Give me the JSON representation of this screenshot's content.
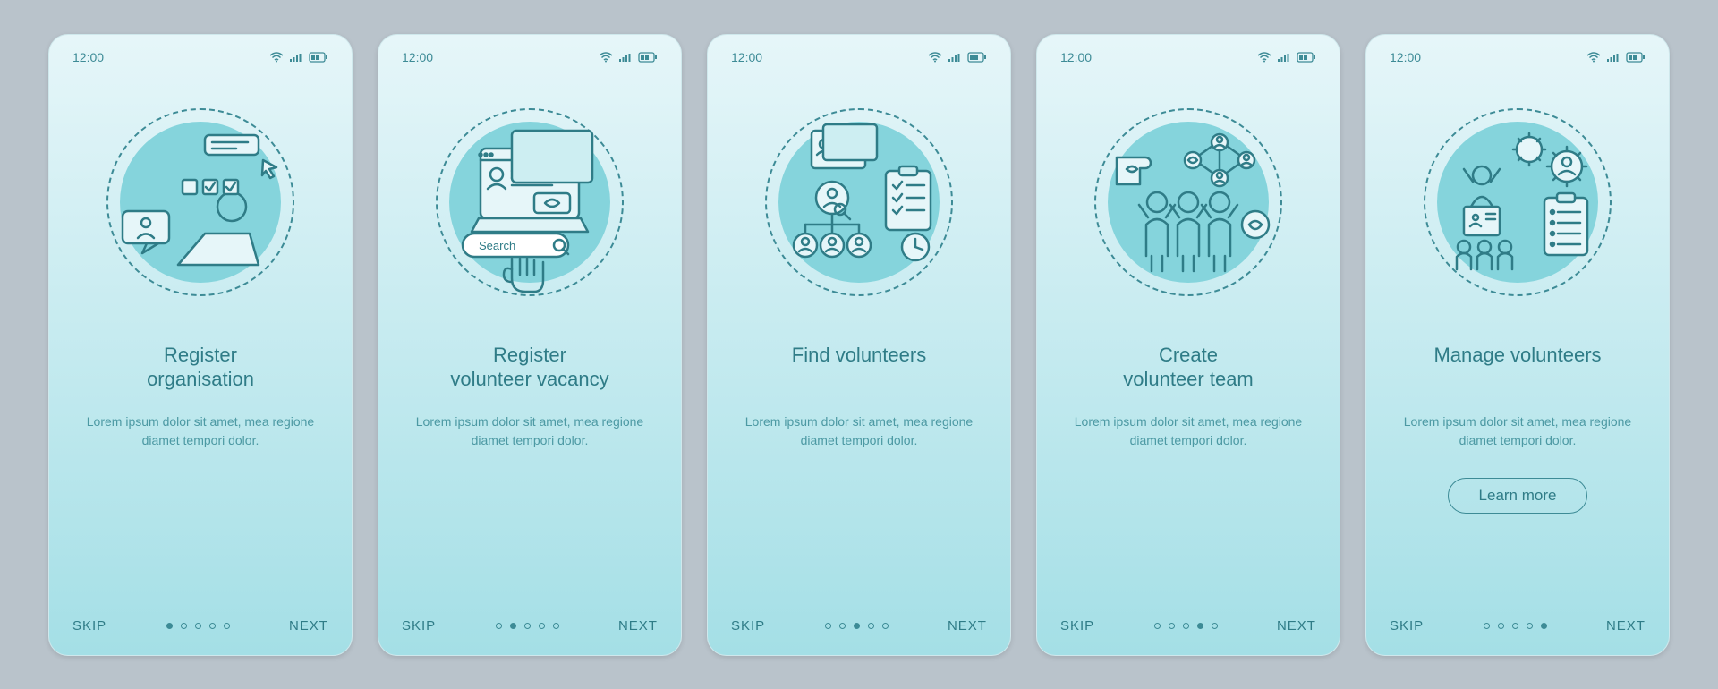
{
  "status": {
    "time": "12:00"
  },
  "screens": [
    {
      "title": "Register\norganisation",
      "body": "Lorem ipsum dolor sit amet, mea regione diamet tempori dolor.",
      "skip": "SKIP",
      "next": "NEXT",
      "activeDot": 0,
      "showCta": false
    },
    {
      "title": "Register\nvolunteer vacancy",
      "body": "Lorem ipsum dolor sit amet, mea regione diamet tempori dolor.",
      "skip": "SKIP",
      "next": "NEXT",
      "activeDot": 1,
      "showCta": false
    },
    {
      "title": "Find volunteers",
      "body": "Lorem ipsum dolor sit amet, mea regione diamet tempori dolor.",
      "skip": "SKIP",
      "next": "NEXT",
      "activeDot": 2,
      "showCta": false
    },
    {
      "title": "Create\nvolunteer team",
      "body": "Lorem ipsum dolor sit amet, mea regione diamet tempori dolor.",
      "skip": "SKIP",
      "next": "NEXT",
      "activeDot": 3,
      "showCta": false
    },
    {
      "title": "Manage volunteers",
      "body": "Lorem ipsum dolor sit amet, mea regione diamet tempori dolor.",
      "skip": "SKIP",
      "next": "NEXT",
      "activeDot": 4,
      "showCta": true,
      "cta": "Learn more"
    }
  ],
  "searchLabel": "Search",
  "colors": {
    "accent": "#3d8b96",
    "bgCircle": "#85d4dc",
    "panelTop": "#e6f6f9",
    "panelBottom": "#a4dfe6"
  }
}
